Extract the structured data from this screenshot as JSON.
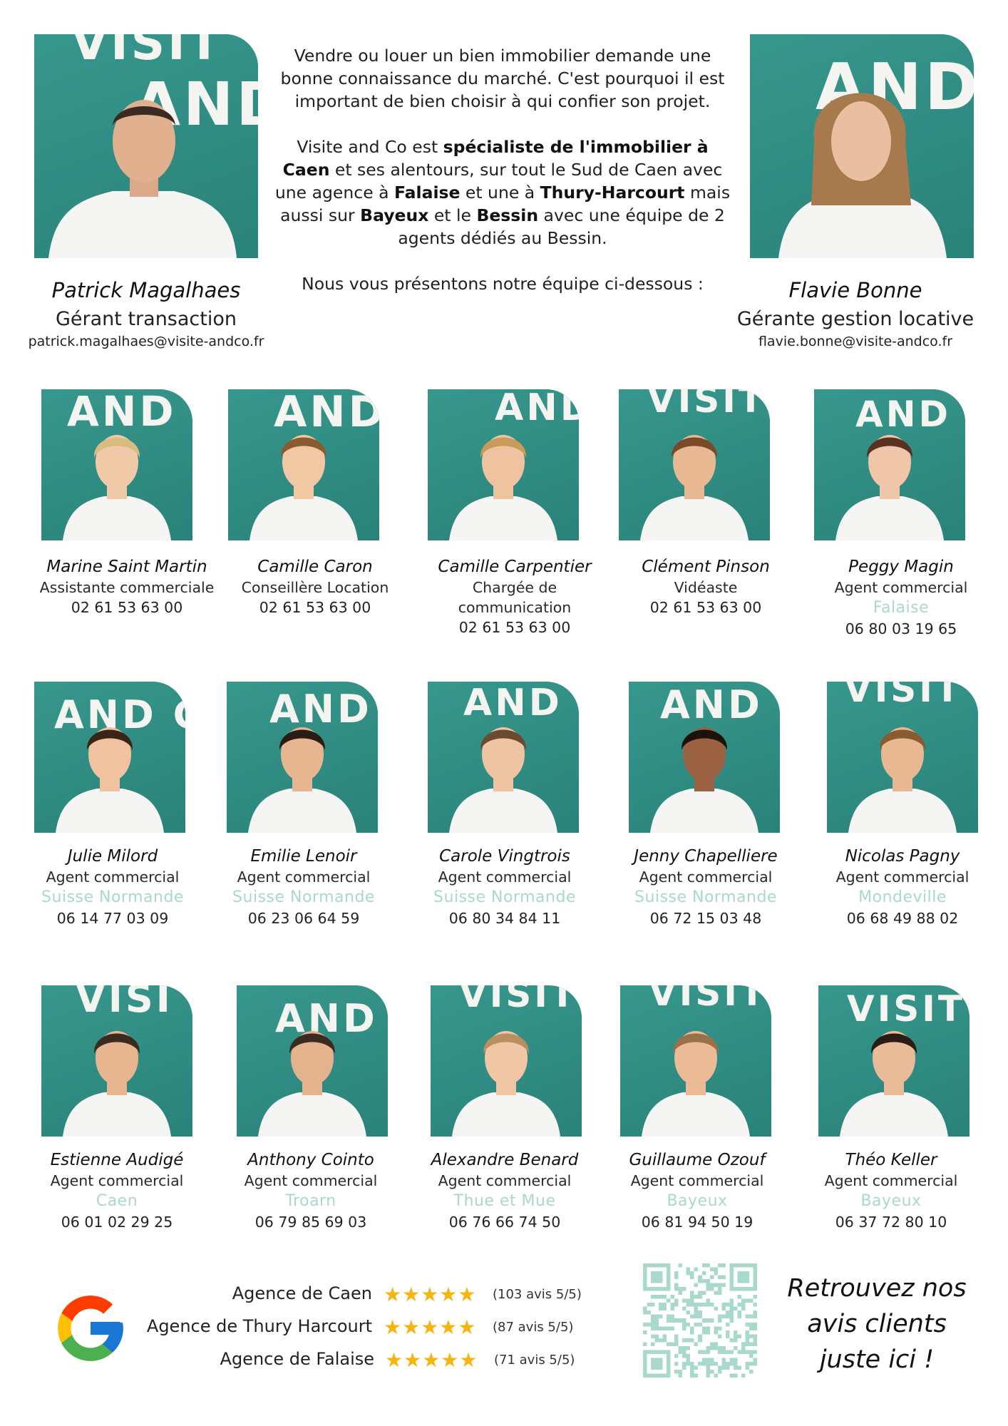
{
  "managers": [
    {
      "name": "Patrick Magalhaes",
      "role": "Gérant transaction",
      "email": "patrick.magalhaes@visite-andco.fr"
    },
    {
      "name": "Flavie Bonne",
      "role": "Gérante gestion locative",
      "email": "flavie.bonne@visite-andco.fr"
    }
  ],
  "intro": {
    "p1": "Vendre ou louer un bien immobilier demande une bonne connaissance du marché. C'est pourquoi il est important de bien choisir à qui confier son projet.",
    "p2_a": "Visite and Co est ",
    "p2_b": "spécialiste de l'immobilier à Caen",
    "p2_c": " et ses alentours, sur tout le Sud de Caen avec une agence à ",
    "p2_d": "Falaise",
    "p2_e": " et une à ",
    "p2_f": "Thury-Harcourt",
    "p2_g": " mais aussi sur ",
    "p2_h": "Bayeux",
    "p2_i": " et le ",
    "p2_j": "Bessin",
    "p2_k": " avec une équipe de 2 agents dédiés au Bessin.",
    "p3": "Nous vous présentons notre équipe ci-dessous :"
  },
  "team": [
    {
      "name": "Marine Saint Martin",
      "role": "Assistante commerciale",
      "location": "",
      "phone": "02 61 53 63 00"
    },
    {
      "name": "Camille Caron",
      "role": "Conseillère Location",
      "location": "",
      "phone": "02 61 53 63 00"
    },
    {
      "name": "Camille Carpentier",
      "role": "Chargée de communication",
      "location": "",
      "phone": "02 61 53 63 00"
    },
    {
      "name": "Clément Pinson",
      "role": "Vidéaste",
      "location": "",
      "phone": "02 61 53 63 00"
    },
    {
      "name": "Peggy Magin",
      "role": "Agent commercial",
      "location": "Falaise",
      "phone": "06 80 03 19 65"
    },
    {
      "name": "Julie Milord",
      "role": "Agent commercial",
      "location": "Suisse Normande",
      "phone": "06 14 77 03 09"
    },
    {
      "name": "Emilie Lenoir",
      "role": "Agent commercial",
      "location": "Suisse Normande",
      "phone": "06 23 06 64 59"
    },
    {
      "name": "Carole Vingtrois",
      "role": "Agent commercial",
      "location": "Suisse Normande",
      "phone": "06 80 34 84 11"
    },
    {
      "name": "Jenny Chapelliere",
      "role": "Agent commercial",
      "location": "Suisse Normande",
      "phone": "06 72 15 03 48"
    },
    {
      "name": "Nicolas Pagny",
      "role": "Agent commercial",
      "location": "Mondeville",
      "phone": "06 68 49 88 02"
    },
    {
      "name": "Estienne Audigé",
      "role": "Agent commercial",
      "location": "Caen",
      "phone": "06 01 02 29 25"
    },
    {
      "name": "Anthony Cointo",
      "role": "Agent commercial",
      "location": "Troarn",
      "phone": "06 79 85 69 03"
    },
    {
      "name": "Alexandre Benard",
      "role": "Agent commercial",
      "location": "Thue et Mue",
      "phone": "06 76 66 74 50"
    },
    {
      "name": "Guillaume Ozouf",
      "role": "Agent commercial",
      "location": "Bayeux",
      "phone": "06 81 94 50 19"
    },
    {
      "name": "Théo Keller",
      "role": "Agent commercial",
      "location": "Bayeux",
      "phone": "06 37 72 80 10"
    }
  ],
  "reviews": [
    {
      "agency": "Agence de Caen",
      "stars": "★★★★★",
      "count": "(103 avis 5/5)"
    },
    {
      "agency": "Agence de Thury Harcourt",
      "stars": "★★★★★",
      "count": "(87 avis 5/5)"
    },
    {
      "agency": "Agence de Falaise",
      "stars": "★★★★★",
      "count": "(71 avis 5/5)"
    }
  ],
  "cta": {
    "line1": "Retrouvez nos",
    "line2": "avis clients",
    "line3": "juste ici !"
  },
  "colors": {
    "wall": "#2f8f86",
    "location_text": "#a9d8cd",
    "stars": "#f6b40e"
  }
}
